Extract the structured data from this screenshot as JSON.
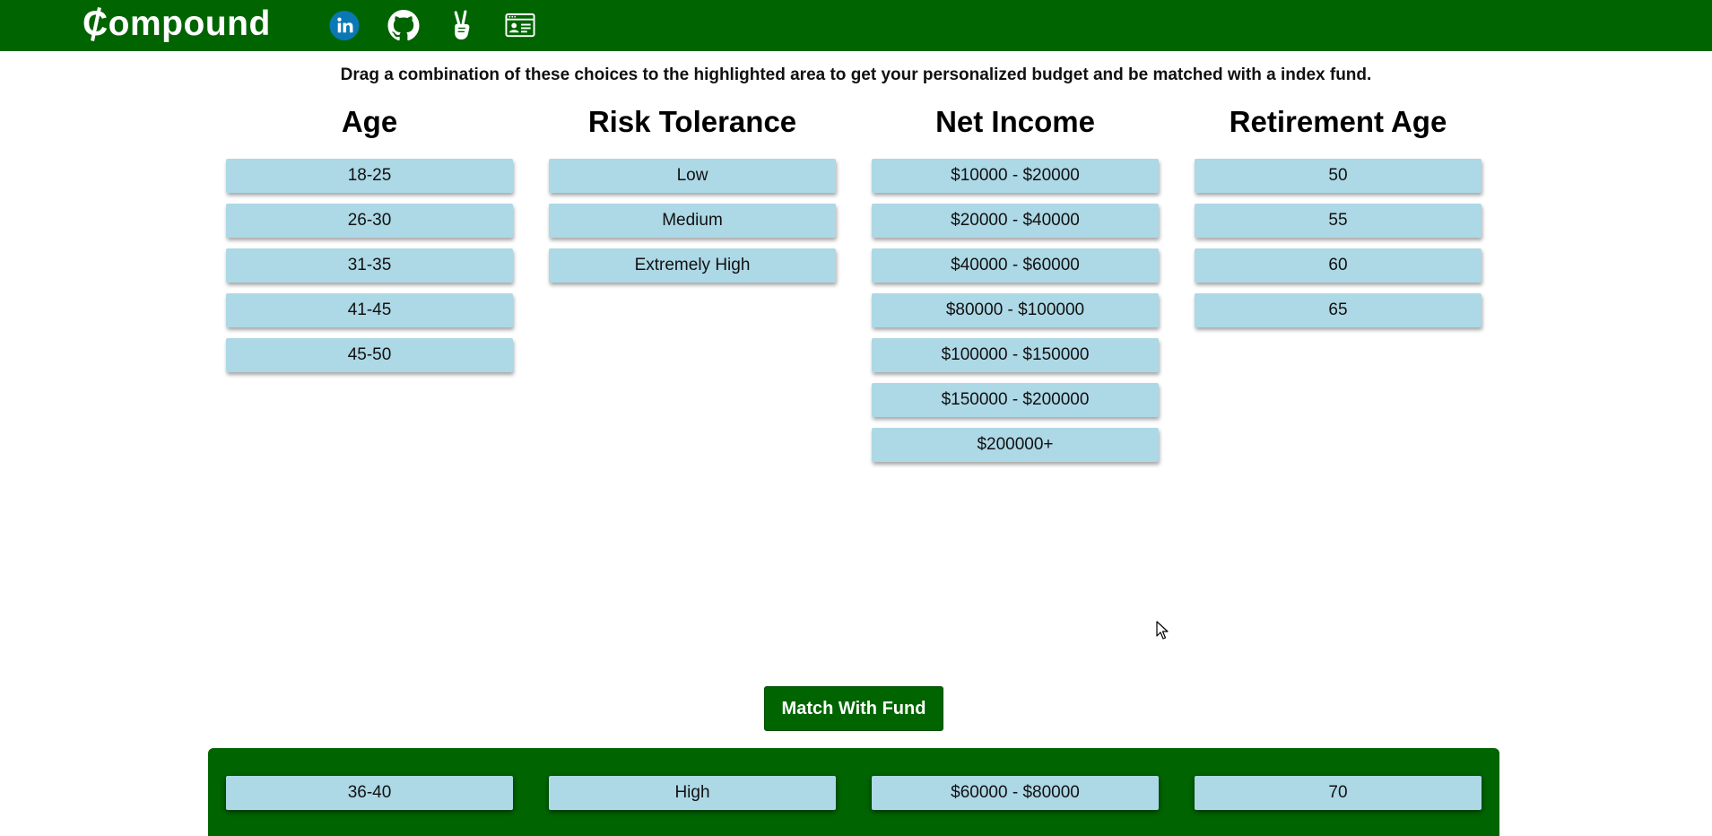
{
  "brand": {
    "name": "ompound"
  },
  "social": [
    {
      "name": "linkedin",
      "icon": "linkedin-icon",
      "color": "#0a78b5"
    },
    {
      "name": "github",
      "icon": "github-icon"
    },
    {
      "name": "angellist",
      "icon": "peace-hand-icon"
    },
    {
      "name": "portfolio",
      "icon": "id-card-icon"
    }
  ],
  "instructions": "Drag a combination of these choices to the highlighted area to get your personalized budget and be matched with a index fund.",
  "columns": {
    "age": {
      "title": "Age",
      "options": [
        "18-25",
        "26-30",
        "31-35",
        "41-45",
        "45-50"
      ]
    },
    "risk": {
      "title": "Risk Tolerance",
      "options": [
        "Low",
        "Medium",
        "Extremely High"
      ]
    },
    "income": {
      "title": "Net Income",
      "options": [
        "$10000 - $20000",
        "$20000 - $40000",
        "$40000 - $60000",
        "$80000 - $100000",
        "$100000 - $150000",
        "$150000 - $200000",
        "$200000+"
      ]
    },
    "retirement": {
      "title": "Retirement Age",
      "options": [
        "50",
        "55",
        "60",
        "65"
      ]
    }
  },
  "match_button": "Match With Fund",
  "selected": {
    "age": "36-40",
    "risk": "High",
    "income": "$60000 - $80000",
    "retirement": "70"
  },
  "colors": {
    "header": "#006400",
    "chip": "#add8e6",
    "dropzone": "#006400"
  }
}
